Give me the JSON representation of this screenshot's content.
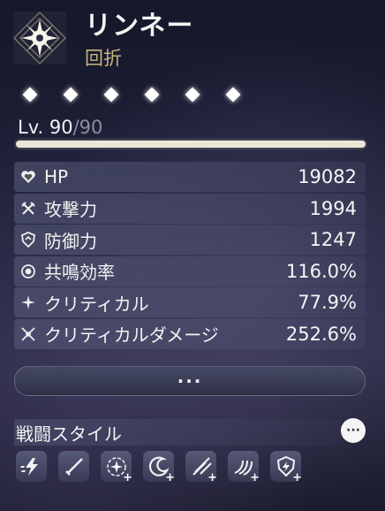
{
  "character": {
    "name": "リンネー",
    "attribute": "回折",
    "attribute_icon": "spectro-emblem-icon"
  },
  "resonance_chain": {
    "unlocked": 6,
    "total": 6
  },
  "level": {
    "current": "Lv. 90",
    "sep": "/",
    "max": "90"
  },
  "stats": [
    {
      "icon": "heart-icon",
      "label": "HP",
      "value": "19082"
    },
    {
      "icon": "crossed-swords-icon",
      "label": "攻撃力",
      "value": "1994"
    },
    {
      "icon": "shield-icon",
      "label": "防御力",
      "value": "1247"
    },
    {
      "icon": "resonance-ring-icon",
      "label": "共鳴効率",
      "value": "116.0%"
    },
    {
      "icon": "crit-star-icon",
      "label": "クリティカル",
      "value": "77.9%"
    },
    {
      "icon": "crit-damage-icon",
      "label": "クリティカルダメージ",
      "value": "252.6%"
    }
  ],
  "more_button": {
    "label": "···"
  },
  "combat_style": {
    "title": "戦闘スタイル",
    "info_label": "···",
    "icons": [
      {
        "name": "lightning-dash-icon",
        "plus": ""
      },
      {
        "name": "slash-icon",
        "plus": ""
      },
      {
        "name": "sparkle-circle-icon",
        "plus": "+"
      },
      {
        "name": "moon-swirl-icon",
        "plus": "+"
      },
      {
        "name": "multi-slash-icon",
        "plus": "+"
      },
      {
        "name": "wind-waves-icon",
        "plus": "+"
      },
      {
        "name": "shield-bolt-icon",
        "plus": "+"
      }
    ]
  }
}
